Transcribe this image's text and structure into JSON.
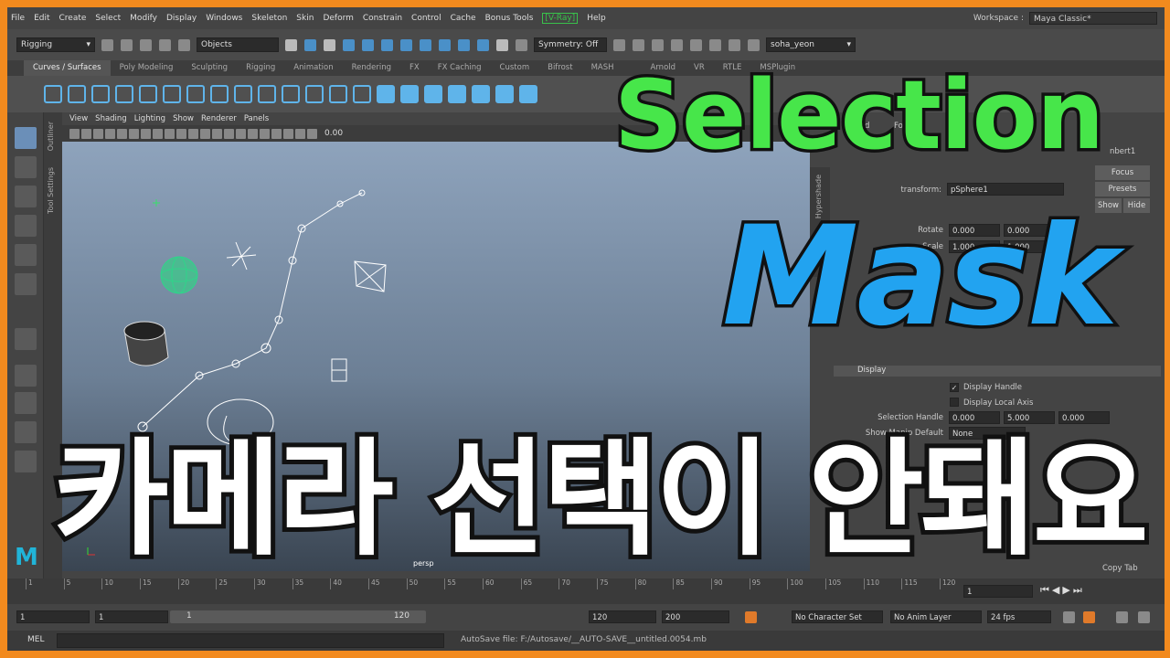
{
  "menu": [
    "File",
    "Edit",
    "Create",
    "Select",
    "Modify",
    "Display",
    "Windows",
    "Skeleton",
    "Skin",
    "Deform",
    "Constrain",
    "Control",
    "Cache",
    "Bonus Tools",
    "[V-Ray]",
    "Help"
  ],
  "workspace": {
    "label": "Workspace :",
    "value": "Maya Classic*"
  },
  "status": {
    "mode": "Rigging",
    "select_by": "Objects",
    "symmetry": "Symmetry: Off",
    "user": "soha_yeon"
  },
  "shelf_tabs": [
    "Curves / Surfaces",
    "Poly Modeling",
    "Sculpting",
    "Rigging",
    "Animation",
    "Rendering",
    "FX",
    "FX Caching",
    "Custom",
    "Bifrost",
    "MASH",
    "",
    "Arnold",
    "VR",
    "RTLE",
    "MSPlugin"
  ],
  "viewport": {
    "menu": [
      "View",
      "Shading",
      "Lighting",
      "Show",
      "Renderer",
      "Panels"
    ],
    "exposure": "0.00",
    "camera_label": "persp"
  },
  "side_tabs": {
    "outliner": "Outliner",
    "tool_settings": "Tool Settings",
    "hypershade": "Hypershade"
  },
  "attr": {
    "tab_partial": "nbert1",
    "tab_frag": [
      "d",
      "Fo"
    ],
    "transform_label": "transform:",
    "transform_value": "pSphere1",
    "focus": "Focus",
    "presets": "Presets",
    "show": "Show",
    "hide": "Hide",
    "rotate_label": "Rotate",
    "rotate": [
      "0.000",
      "0.000"
    ],
    "scale_label": "Scale",
    "scale": [
      "1.000",
      "1.000"
    ],
    "display_section": "Display",
    "display_handle": "Display Handle",
    "display_local_axis": "Display Local Axis",
    "sel_handle_label": "Selection Handle",
    "sel_handle": [
      "0.000",
      "5.000",
      "0.000"
    ],
    "show_manip_label": "Show Manip Default",
    "show_manip": "None",
    "copy_tab": "Copy Tab"
  },
  "timeline": {
    "ticks": [
      "1",
      "5",
      "10",
      "15",
      "20",
      "25",
      "30",
      "35",
      "40",
      "45",
      "50",
      "55",
      "60",
      "65",
      "70",
      "75",
      "80",
      "85",
      "90",
      "95",
      "100",
      "105",
      "110",
      "115",
      "120"
    ],
    "current": "1"
  },
  "range": {
    "start": "1",
    "inner_start": "1",
    "slider_start": "1",
    "slider_end": "120",
    "end": "120",
    "anim_end": "200",
    "char_set": "No Character Set",
    "anim_layer": "No Anim Layer",
    "fps": "24 fps"
  },
  "cmd": {
    "label": "MEL",
    "feedback": "AutoSave file: F:/Autosave/__AUTO-SAVE__untitled.0054.mb"
  },
  "overlay": {
    "line1": "Selection",
    "line2": "Mask",
    "line3": "카메라 선택이 안돼요"
  },
  "colors": {
    "accent_blue": "#5fb4ea",
    "overlay_green": "#47e64a",
    "overlay_blue": "#22a3f0",
    "frame": "#f28a1e"
  }
}
